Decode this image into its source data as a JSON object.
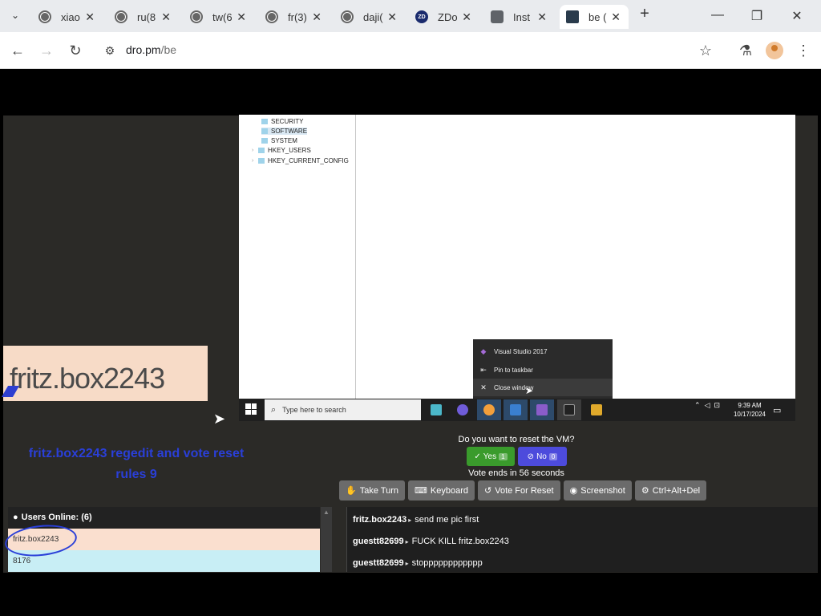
{
  "browser": {
    "tabs": [
      {
        "label": "xiao",
        "icon": "globe-icon"
      },
      {
        "label": "ru(8",
        "icon": "globe-icon"
      },
      {
        "label": "tw(6",
        "icon": "globe-icon"
      },
      {
        "label": "fr(3)",
        "icon": "globe-icon"
      },
      {
        "label": "daji(",
        "icon": "globe-icon"
      },
      {
        "label": "ZDo",
        "icon": "zd-icon"
      },
      {
        "label": "Inst",
        "icon": "instagram-icon"
      },
      {
        "label": "be (",
        "icon": "site-icon",
        "active": true
      }
    ],
    "url_host": "dro.pm",
    "url_path": "/be"
  },
  "vm": {
    "registry_items": [
      "SECURITY",
      "SOFTWARE",
      "SYSTEM",
      "HKEY_USERS",
      "HKEY_CURRENT_CONFIG"
    ],
    "jumplist": {
      "app": "Visual Studio 2017",
      "pin": "Pin to taskbar",
      "close": "Close window"
    },
    "taskbar": {
      "search_placeholder": "Type here to search",
      "time": "9:39 AM",
      "date": "10/17/2024"
    }
  },
  "username_image_text": "fritz.box2243",
  "blue_message": {
    "line1": "fritz.box2243 regedit and vote reset",
    "line2": "rules 9"
  },
  "vote": {
    "question": "Do you want to reset the VM?",
    "yes_label": "Yes",
    "yes_count": "1",
    "no_label": "No",
    "no_count": "0",
    "ends": "Vote ends in 56 seconds"
  },
  "actions": {
    "take_turn": "Take Turn",
    "keyboard": "Keyboard",
    "vote_reset": "Vote For Reset",
    "screenshot": "Screenshot",
    "cad": "Ctrl+Alt+Del"
  },
  "users": {
    "header": "Users Online: (6)",
    "list": [
      "fritz.box2243",
      "8176"
    ]
  },
  "chat": [
    {
      "user": "fritz.box2243",
      "message": "send me pic first"
    },
    {
      "user": "guestt82699",
      "message": "FUCK KILL fritz.box2243"
    },
    {
      "user": "guestt82699",
      "message": "stopppppppppppp"
    }
  ],
  "colors": {
    "vote_yes": "#3a9b2c",
    "vote_no": "#4d4bdc",
    "annotation_blue": "#2a3fd8"
  }
}
